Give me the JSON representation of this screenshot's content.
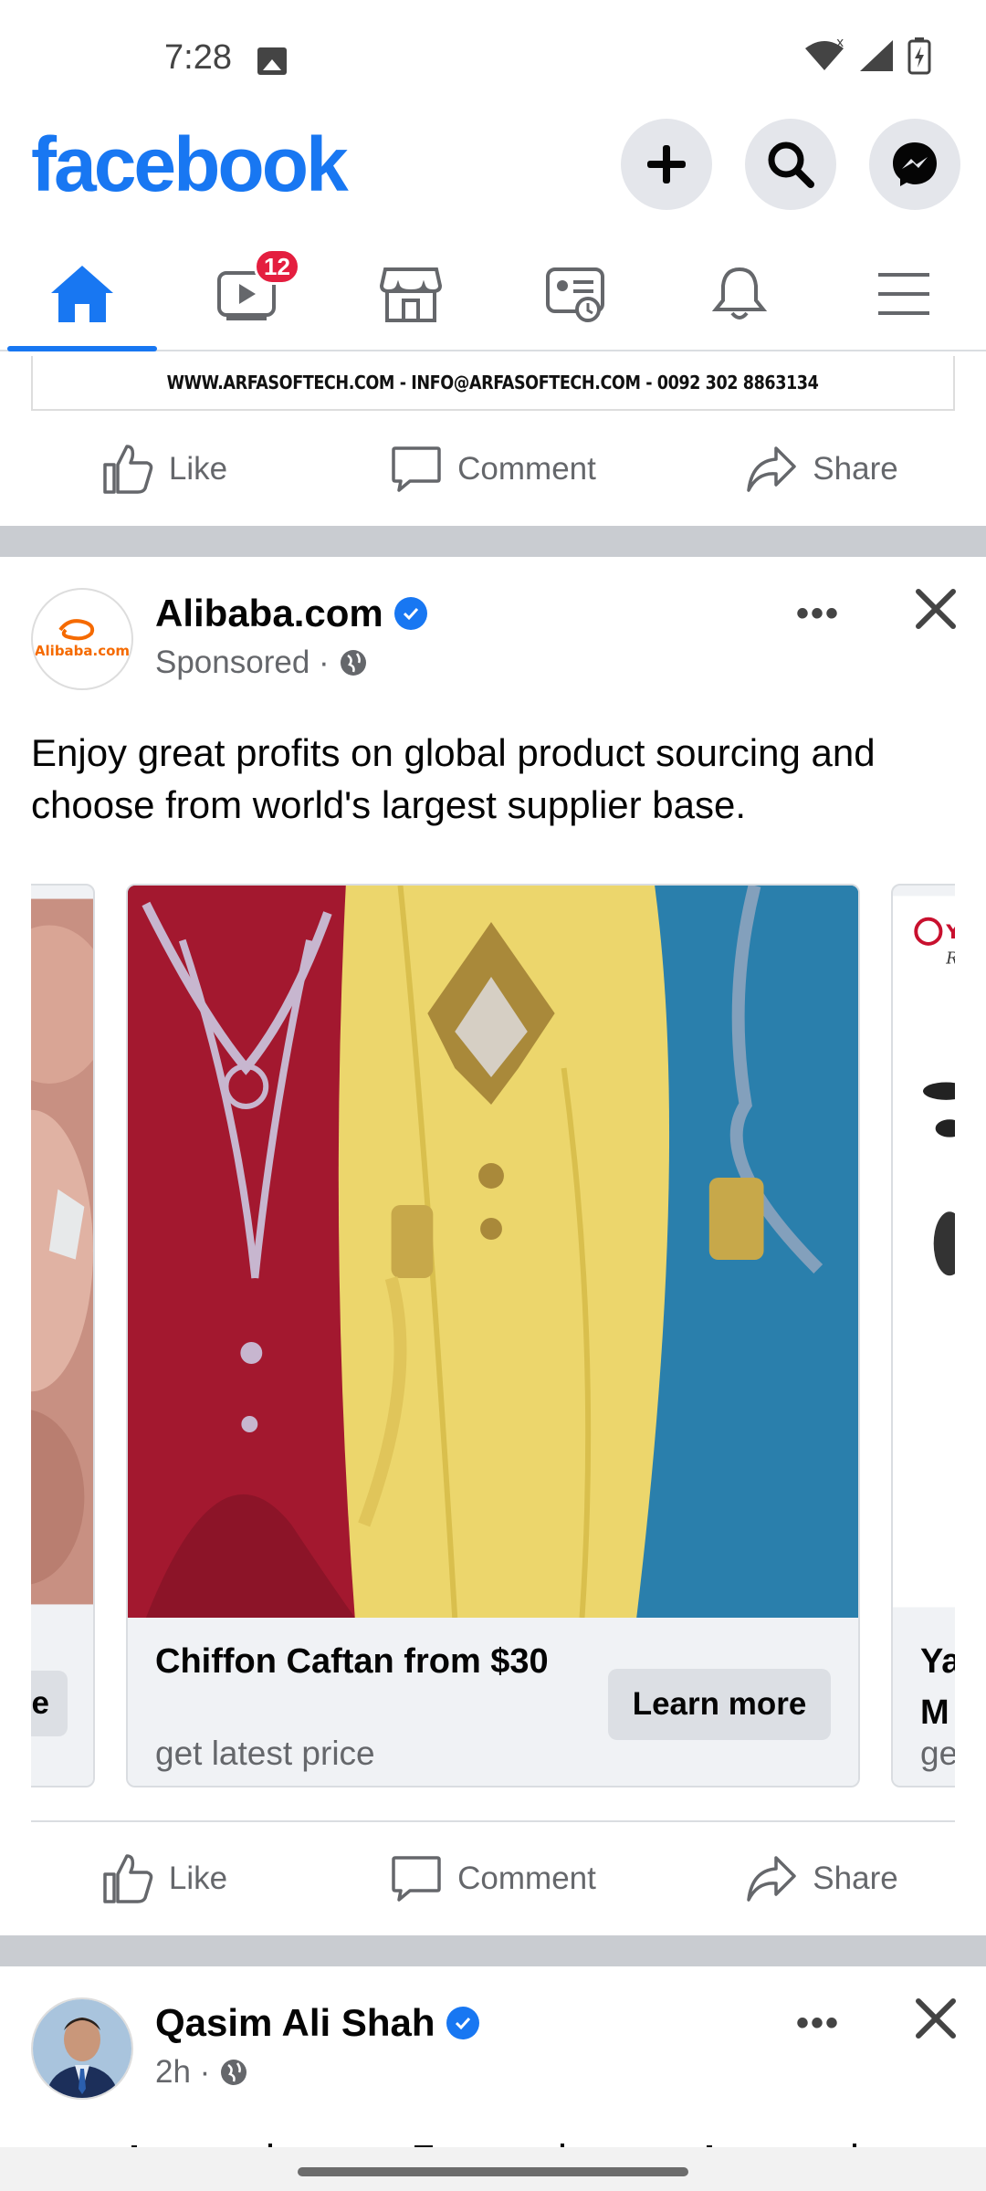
{
  "status_bar": {
    "time": "7:28",
    "icons": [
      "image-icon",
      "wifi-icon",
      "signal-icon",
      "battery-charging-icon"
    ]
  },
  "header": {
    "logo": "facebook",
    "buttons": [
      "add-icon",
      "search-icon",
      "messenger-icon"
    ]
  },
  "nav": {
    "tabs": [
      {
        "name": "home",
        "icon": "home-icon",
        "active": true
      },
      {
        "name": "video",
        "icon": "video-icon",
        "badge": "12"
      },
      {
        "name": "marketplace",
        "icon": "marketplace-icon"
      },
      {
        "name": "news",
        "icon": "news-icon"
      },
      {
        "name": "notifications",
        "icon": "bell-icon"
      },
      {
        "name": "menu",
        "icon": "menu-icon"
      }
    ]
  },
  "prev_post": {
    "banner_text": "WWW.ARFASOFTECH.COM - INFO@ARFASOFTECH.COM - 0092 302 8863134",
    "actions": {
      "like": "Like",
      "comment": "Comment",
      "share": "Share"
    }
  },
  "ad_post": {
    "author": "Alibaba.com",
    "avatar_text": "Alibaba.com",
    "meta": "Sponsored ·",
    "text": "Enjoy great profits on global product sourcing and choose from world's largest supplier base.",
    "cards": [
      {
        "partial_label": "e"
      },
      {
        "title": "Chiffon Caftan  from $30",
        "subtitle": "get latest price",
        "cta": "Learn more"
      },
      {
        "title_line1": "Ya",
        "title_line2": "M",
        "subtitle": "ge"
      }
    ],
    "actions": {
      "like": "Like",
      "comment": "Comment",
      "share": "Share"
    }
  },
  "next_post": {
    "author": "Qasim Ali Shah",
    "meta": "2h ·"
  },
  "colors": {
    "brand": "#1877f2",
    "badge": "#e41e3f",
    "secondary_text": "#65676b",
    "separator": "#c9ccd1"
  }
}
